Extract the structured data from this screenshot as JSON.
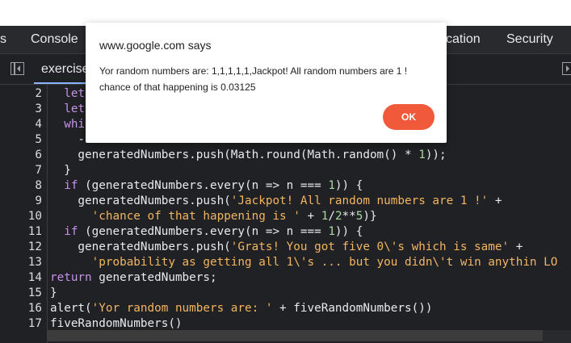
{
  "devtools": {
    "tabs": [
      "s",
      "Console",
      "cation",
      "Security"
    ]
  },
  "file_tab": {
    "label": "exercise"
  },
  "code_lines": [
    {
      "n": "2",
      "text": "  let"
    },
    {
      "n": "3",
      "text": "  let"
    },
    {
      "n": "4",
      "text": "  whi"
    },
    {
      "n": "5",
      "text": "    -"
    },
    {
      "n": "6",
      "text": "    generatedNumbers.push(Math.round(Math.random() * 1));"
    },
    {
      "n": "7",
      "text": "  }"
    },
    {
      "n": "8",
      "text": "  if (generatedNumbers.every(n => n === 1)) {"
    },
    {
      "n": "9",
      "text": "    generatedNumbers.push('Jackpot! All random numbers are 1 !' +"
    },
    {
      "n": "10",
      "text": "      'chance of that happening is ' + 1/2**5)}"
    },
    {
      "n": "11",
      "text": "  if (generatedNumbers.every(n => n === 1)) {"
    },
    {
      "n": "12",
      "text": "    generatedNumbers.push('Grats! You got five 0\\'s which is same' +"
    },
    {
      "n": "13",
      "text": "      'probability as getting all 1\\'s ... but you didn\\'t win anythin LO"
    },
    {
      "n": "14",
      "text": "return generatedNumbers;"
    },
    {
      "n": "15",
      "text": "}"
    },
    {
      "n": "16",
      "text": "alert('Yor random numbers are: ' + fiveRandomNumbers())"
    },
    {
      "n": "17",
      "text": "fiveRandomNumbers()"
    }
  ],
  "dialog": {
    "origin": "www.google.com says",
    "message": "Yor random numbers are: 1,1,1,1,1,Jackpot! All random numbers are 1 ! chance of that happening is 0.03125",
    "ok_label": "OK",
    "accent": "#f05a3a"
  }
}
